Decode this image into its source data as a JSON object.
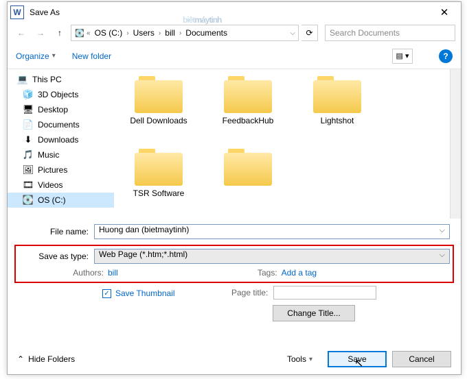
{
  "window": {
    "title": "Save As"
  },
  "nav": {
    "crumbs": [
      "OS (C:)",
      "Users",
      "bill",
      "Documents"
    ],
    "search_placeholder": "Search Documents"
  },
  "toolbar": {
    "organize": "Organize",
    "new_folder": "New folder"
  },
  "tree": {
    "root": "This PC",
    "items": [
      {
        "label": "3D Objects",
        "icon": "🧊"
      },
      {
        "label": "Desktop",
        "icon": "🖥"
      },
      {
        "label": "Documents",
        "icon": "📄"
      },
      {
        "label": "Downloads",
        "icon": "⬇"
      },
      {
        "label": "Music",
        "icon": "🎵"
      },
      {
        "label": "Pictures",
        "icon": "🖼"
      },
      {
        "label": "Videos",
        "icon": "🎞"
      },
      {
        "label": "OS (C:)",
        "icon": "💽",
        "selected": true
      }
    ]
  },
  "folders": [
    "Dell Downloads",
    "FeedbackHub",
    "Lightshot",
    "TSR Software",
    ""
  ],
  "form": {
    "file_name_label": "File name:",
    "file_name": "Huong dan (bietmaytinh)",
    "save_type_label": "Save as type:",
    "save_type": "Web Page (*.htm;*.html)",
    "authors_label": "Authors:",
    "authors": "bill",
    "tags_label": "Tags:",
    "tags": "Add a tag",
    "save_thumb": "Save Thumbnail",
    "page_title_label": "Page title:",
    "change_title": "Change Title..."
  },
  "footer": {
    "hide": "Hide Folders",
    "tools": "Tools",
    "save": "Save",
    "cancel": "Cancel"
  },
  "watermark": {
    "a": "biêt",
    "b": "máytinh"
  }
}
